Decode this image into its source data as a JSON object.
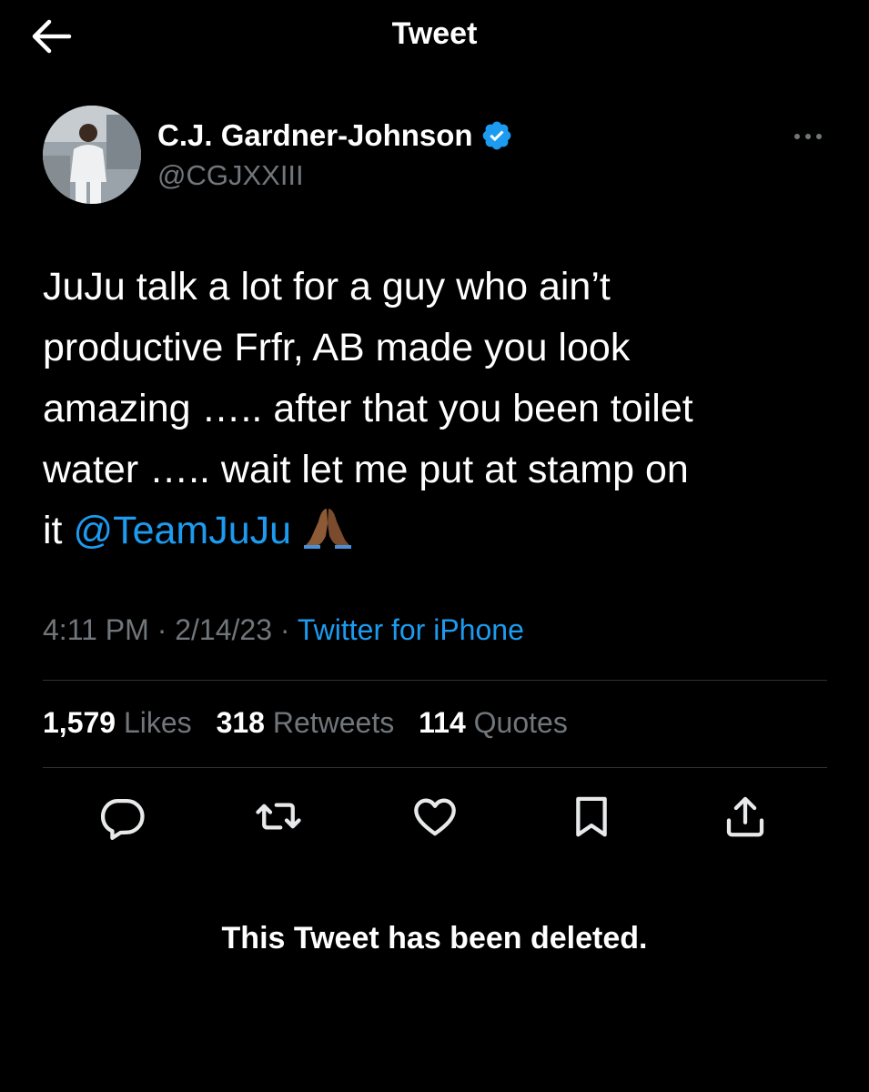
{
  "header": {
    "title": "Tweet",
    "back_icon": "arrow-left-icon"
  },
  "author": {
    "name": "C.J. Gardner-Johnson",
    "handle": "@CGJXXIII",
    "verified": true,
    "verified_color": "#1d9bf0"
  },
  "tweet": {
    "lines": [
      "JuJu talk a lot for a guy who ain’t",
      "productive Frfr, AB made you look",
      "amazing ….. after that you been toilet",
      "water ….. wait let me put at stamp on"
    ],
    "last_line_prefix": "it ",
    "mention": "@TeamJuJu",
    "emoji": "folded-hands-icon",
    "time": "4:11 PM",
    "date": "2/14/23",
    "separator": " · ",
    "source": "Twitter for iPhone"
  },
  "stats": {
    "likes_count": "1,579",
    "likes_label": "Likes",
    "retweets_count": "318",
    "retweets_label": "Retweets",
    "quotes_count": "114",
    "quotes_label": "Quotes"
  },
  "actions": [
    "reply-icon",
    "retweet-icon",
    "like-icon",
    "bookmark-icon",
    "share-icon"
  ],
  "status_message": "This Tweet has been deleted.",
  "colors": {
    "background": "#000000",
    "text": "#ffffff",
    "secondary_text": "#71767b",
    "link": "#1d9bf0",
    "divider": "#2f3336"
  }
}
